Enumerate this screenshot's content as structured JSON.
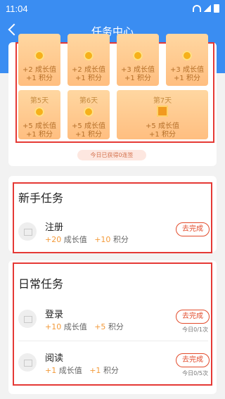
{
  "status_bar": {
    "time": "11:04"
  },
  "header": {
    "title": "任务中心"
  },
  "days": [
    {
      "label": "",
      "growth": "+2 成长值",
      "points": "+1 积分"
    },
    {
      "label": "",
      "growth": "+2 成长值",
      "points": "+1 积分"
    },
    {
      "label": "",
      "growth": "+3 成长值",
      "points": "+1 积分"
    },
    {
      "label": "",
      "growth": "+3 成长值",
      "points": "+1 积分"
    },
    {
      "label": "第5天",
      "growth": "+5 成长值",
      "points": "+1 积分"
    },
    {
      "label": "第6天",
      "growth": "+5 成长值",
      "points": "+1 积分"
    },
    {
      "label": "第7天",
      "growth": "+5 成长值",
      "points": "+1 积分"
    }
  ],
  "streak_text": "今日已获得0连签",
  "newbie": {
    "title": "新手任务",
    "tasks": [
      {
        "name": "注册",
        "growth_value": "+20",
        "growth_label": "成长值",
        "points_value": "+10",
        "points_label": "积分",
        "action": "去完成"
      }
    ]
  },
  "daily": {
    "title": "日常任务",
    "tasks": [
      {
        "name": "登录",
        "growth_value": "+10",
        "growth_label": "成长值",
        "points_value": "+5",
        "points_label": "积分",
        "action": "去完成",
        "progress": "今日0/1次"
      },
      {
        "name": "阅读",
        "growth_value": "+1",
        "growth_label": "成长值",
        "points_value": "+1",
        "points_label": "积分",
        "action": "去完成",
        "progress": "今日0/5次"
      }
    ]
  }
}
